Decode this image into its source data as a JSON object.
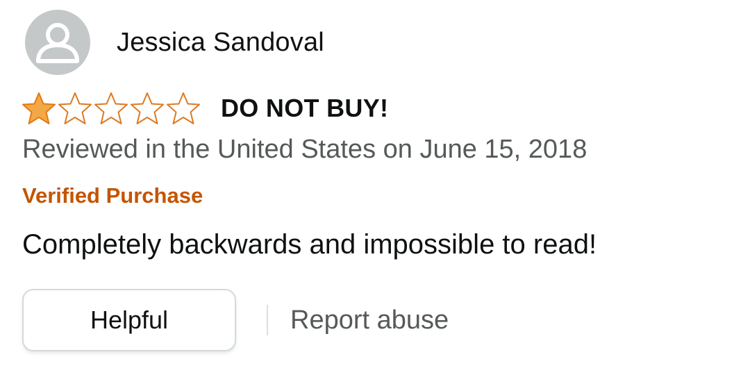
{
  "reviewer": {
    "name": "Jessica Sandoval",
    "avatar_icon": "default-user-avatar-icon"
  },
  "review": {
    "rating": 1,
    "max_rating": 5,
    "title": "DO NOT BUY!",
    "date_line": "Reviewed in the United States on June 15, 2018",
    "badge": "Verified Purchase",
    "body": "Completely backwards and impossible to read!"
  },
  "actions": {
    "helpful_label": "Helpful",
    "report_label": "Report abuse"
  },
  "colors": {
    "star_filled": "#f3a847",
    "star_empty_outline": "#de7921",
    "verified": "#c45500",
    "muted_text": "#565959"
  }
}
